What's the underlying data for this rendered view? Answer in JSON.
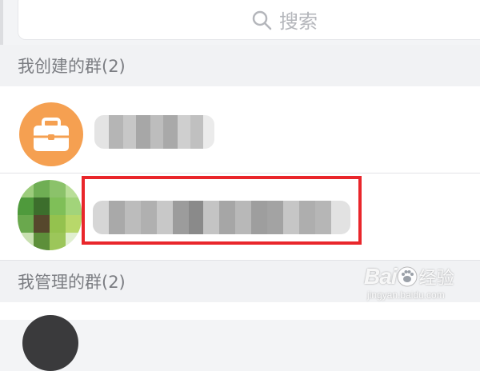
{
  "search": {
    "placeholder": "搜索"
  },
  "sections": [
    {
      "title": "我创建的群(2)"
    },
    {
      "title": "我管理的群(2)"
    }
  ],
  "groups_created": [
    {
      "icon": "briefcase-icon",
      "name_redacted": true
    },
    {
      "icon": "pixelated-avatar-icon",
      "name_redacted": true,
      "highlighted": true
    }
  ],
  "colors": {
    "accent_orange": "#f5a051",
    "highlight_red": "#e9262b",
    "header_text": "#7b7d82"
  },
  "watermark": {
    "brand": "Bai",
    "name": "经验",
    "url": "jingyan.baidu.com"
  }
}
